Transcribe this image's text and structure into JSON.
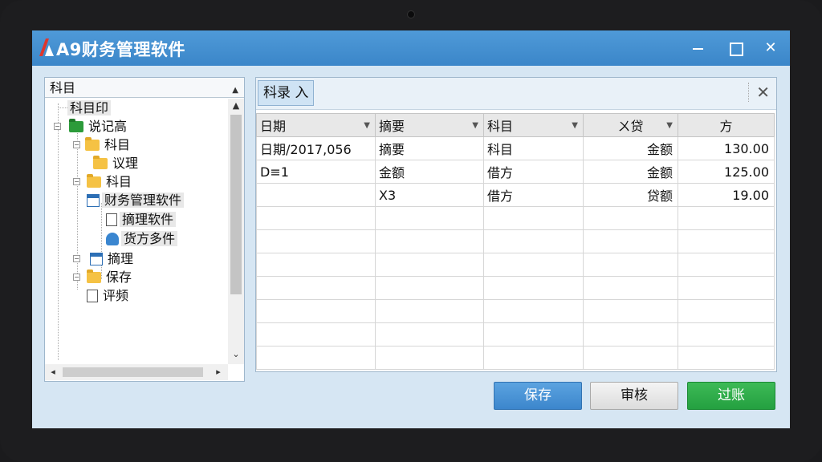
{
  "app": {
    "title": "A9财务管理软件",
    "brand_color": "#3b86c9"
  },
  "tree": {
    "header": "科目",
    "nodes": [
      {
        "label": "科目印",
        "icon": "none",
        "highlight": true
      },
      {
        "label": "说记高",
        "icon": "folder-green-icon",
        "highlight": false
      },
      {
        "label": "科目",
        "icon": "folder-icon",
        "highlight": false
      },
      {
        "label": "议理",
        "icon": "folder-icon",
        "highlight": false
      },
      {
        "label": "科目",
        "icon": "folder-icon",
        "highlight": false
      },
      {
        "label": "财务管理软件",
        "icon": "document-icon",
        "highlight": true
      },
      {
        "label": "摘理软件",
        "icon": "document-icon",
        "highlight": true
      },
      {
        "label": "货方多件",
        "icon": "database-icon",
        "highlight": true
      },
      {
        "label": "摘理",
        "icon": "document-icon",
        "highlight": false
      },
      {
        "label": "保存",
        "icon": "folder-icon",
        "highlight": false
      },
      {
        "label": "评频",
        "icon": "document-icon",
        "highlight": false
      }
    ]
  },
  "grid": {
    "tab_label": "科录 入",
    "columns": [
      "日期",
      "摘要",
      "科目",
      "ㄨ贷",
      "方"
    ],
    "rows": [
      [
        "日期/2017,056",
        "摘要",
        "科目",
        "金额",
        "130.00"
      ],
      [
        "D≡1",
        "金额",
        "借方",
        "金额",
        "125.00"
      ],
      [
        "",
        "X3",
        "借方",
        "贷额",
        "19.00"
      ],
      [
        "",
        "",
        "",
        "",
        ""
      ],
      [
        "",
        "",
        "",
        "",
        ""
      ],
      [
        "",
        "",
        "",
        "",
        ""
      ],
      [
        "",
        "",
        "",
        "",
        ""
      ],
      [
        "",
        "",
        "",
        "",
        ""
      ],
      [
        "",
        "",
        "",
        "",
        ""
      ],
      [
        "",
        "",
        "",
        "",
        ""
      ]
    ]
  },
  "buttons": {
    "save": "保存",
    "audit": "审核",
    "post": "过账"
  },
  "colors": {
    "save_button": "#3c86cc",
    "post_button": "#24a040"
  }
}
